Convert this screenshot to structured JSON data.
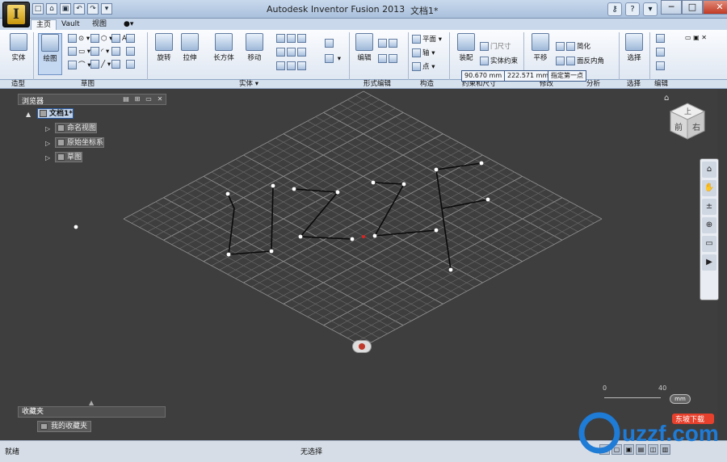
{
  "window": {
    "title": "Autodesk Inventor Fusion 2013",
    "document": "文档1*"
  },
  "app_button": {
    "label": "I"
  },
  "qat": [
    "□",
    "⌂",
    "▣",
    "↶",
    "↷",
    "▾"
  ],
  "help": {
    "key": "⚷",
    "question": "?",
    "arrow": "▾"
  },
  "window_controls": {
    "min": "─",
    "max": "□",
    "close": "✕"
  },
  "tabs": [
    {
      "label": "主页",
      "active": true
    },
    {
      "label": "Vault"
    },
    {
      "label": "视图"
    },
    {
      "label": "●▾"
    }
  ],
  "ribbon": {
    "tools": [
      {
        "label": "实体"
      },
      {
        "label": "绘图"
      },
      {
        "label": "旋转"
      },
      {
        "label": "拉伸"
      },
      {
        "label": "长方体"
      },
      {
        "label": "移动"
      },
      {
        "label": "编辑"
      },
      {
        "label": "装配"
      },
      {
        "label": "平移"
      },
      {
        "label": "选择"
      }
    ],
    "small": {
      "sketch_top": "平面",
      "axis": "轴",
      "point": "点",
      "dim": "门尺寸",
      "constraint": "实体约束",
      "simplify": "简化",
      "analysis": "面反内角"
    },
    "panels": [
      {
        "label": "造型"
      },
      {
        "label": "草图"
      },
      {
        "label": "实体 ▾"
      },
      {
        "label": "形式编辑"
      },
      {
        "label": "构造"
      },
      {
        "label": "约束和尺寸"
      },
      {
        "label": "修改"
      },
      {
        "label": "分析"
      },
      {
        "label": "选择"
      },
      {
        "label": "编辑"
      }
    ],
    "dim_inputs": [
      "90.670 mm",
      "222.571 mm",
      "指定第一点"
    ]
  },
  "browser": {
    "title": "浏览器",
    "root": "文档1*",
    "nodes": [
      {
        "label": "命名视图"
      },
      {
        "label": "原始坐标系"
      },
      {
        "label": "草图"
      }
    ],
    "controls": [
      "▤",
      "⊞",
      "▭",
      "✕"
    ]
  },
  "viewcube": {
    "top": "上",
    "front": "前",
    "right": "右"
  },
  "navbar": [
    "⌂",
    "✋",
    "±",
    "⊕",
    "▭",
    "▶"
  ],
  "scale": {
    "zero": "0",
    "forty": "40",
    "unit": "mm"
  },
  "favorites": {
    "title": "收藏夹",
    "item": "我的收藏夹"
  },
  "status": {
    "left": "就绪",
    "center": "无选择"
  },
  "status_icons": [
    "▦",
    "▢",
    "▣",
    "▤",
    "◫",
    "▥"
  ],
  "watermark": {
    "text": "uzzf.com",
    "sub": "东坡下载"
  },
  "colors": {
    "viewport": "#3e3e3e",
    "accent": "#2a5aa0",
    "watermark": "#1e7bd6"
  }
}
